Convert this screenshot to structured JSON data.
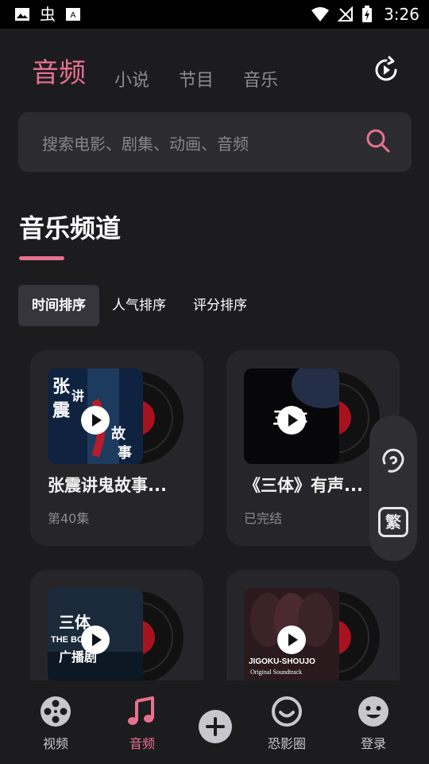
{
  "status_bar": {
    "time": "3:26",
    "carrier_glyph": "虫"
  },
  "top_tabs": {
    "audio": "音频",
    "novel": "小说",
    "program": "节目",
    "music": "音乐"
  },
  "search": {
    "placeholder": "搜索电影、剧集、动画、音频"
  },
  "section": {
    "title": "音乐频道"
  },
  "sort": {
    "time": "时间排序",
    "hot": "人气排序",
    "score": "评分排序"
  },
  "cards": [
    {
      "title": "张震讲鬼故事...",
      "subtitle": "第40集",
      "cover_text": "张讲震鬼故事"
    },
    {
      "title": "《三体》有声...",
      "subtitle": "已完结",
      "cover_text": "三体"
    },
    {
      "title": "",
      "subtitle": "",
      "cover_text": "三体 THE BODY 广播剧"
    },
    {
      "title": "",
      "subtitle": "",
      "cover_text": "JIGOKU-SHOUJO Original Soundtrack"
    }
  ],
  "side_panel": {
    "trad_label": "繁"
  },
  "nav": {
    "video": "视频",
    "audio": "音频",
    "circle": "恐影圈",
    "login": "登录"
  },
  "colors": {
    "accent": "#e8718f",
    "background": "#1c1c1f",
    "card": "#26262a"
  }
}
